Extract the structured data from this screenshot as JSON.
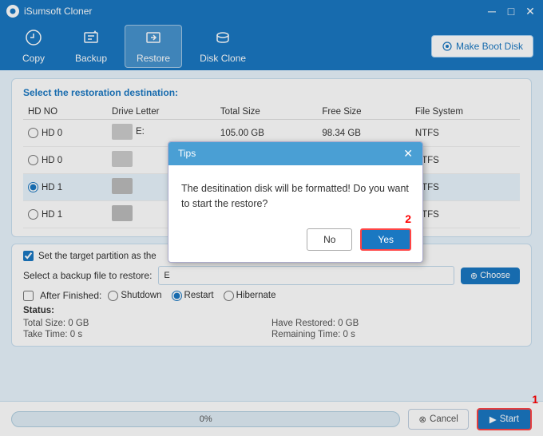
{
  "titleBar": {
    "title": "iSumsoft Cloner",
    "controls": [
      "minimize",
      "maximize",
      "close"
    ]
  },
  "toolbar": {
    "items": [
      {
        "id": "copy",
        "label": "Copy",
        "icon": "⟳"
      },
      {
        "id": "backup",
        "label": "Backup",
        "icon": "⊞"
      },
      {
        "id": "restore",
        "label": "Restore",
        "icon": "⊡"
      },
      {
        "id": "diskclone",
        "label": "Disk Clone",
        "icon": "⊠"
      }
    ],
    "makeBootDisk": "Make Boot Disk"
  },
  "restorePanel": {
    "title": "Select the restoration destination:",
    "columns": [
      "HD NO",
      "Drive Letter",
      "Total Size",
      "Free Size",
      "File System"
    ],
    "rows": [
      {
        "hdno": "HD 0",
        "selected": false,
        "letter": "E:",
        "totalSize": "105.00 GB",
        "freeSize": "98.34 GB",
        "fs": "NTFS"
      },
      {
        "hdno": "HD 0",
        "selected": false,
        "letter": "",
        "totalSize": "",
        "freeSize": "",
        "fs": "NTFS"
      },
      {
        "hdno": "HD 1",
        "selected": true,
        "letter": "",
        "totalSize": "",
        "freeSize": "",
        "fs": "NTFS"
      },
      {
        "hdno": "HD 1",
        "selected": false,
        "letter": "",
        "totalSize": "",
        "freeSize": "",
        "fs": "NTFS"
      }
    ]
  },
  "bottomPanel": {
    "targetPartitionLabel": "Set the target partition as the",
    "backupFileLabel": "Select a backup file to restore:",
    "backupFileValue": "E",
    "chooseLabel": "Choose",
    "afterFinishedLabel": "After Finished:",
    "radioOptions": [
      "Shutdown",
      "Restart",
      "Hibernate"
    ],
    "selectedRadio": "Restart",
    "statusTitle": "Status:",
    "statusItems": [
      {
        "label": "Total Size: 0 GB",
        "key": "totalSize"
      },
      {
        "label": "Have Restored: 0 GB",
        "key": "haveRestored"
      },
      {
        "label": "Take Time: 0 s",
        "key": "takeTime"
      },
      {
        "label": "Remaining Time: 0 s",
        "key": "remainingTime"
      }
    ]
  },
  "bottomBar": {
    "progressPercent": "0%",
    "cancelLabel": "Cancel",
    "startLabel": "Start"
  },
  "modal": {
    "title": "Tips",
    "message": "The desitination disk will be formatted! Do you want to start the restore?",
    "noLabel": "No",
    "yesLabel": "Yes",
    "annotation2Label": "2"
  },
  "annotations": {
    "label1": "1",
    "label2": "2"
  }
}
